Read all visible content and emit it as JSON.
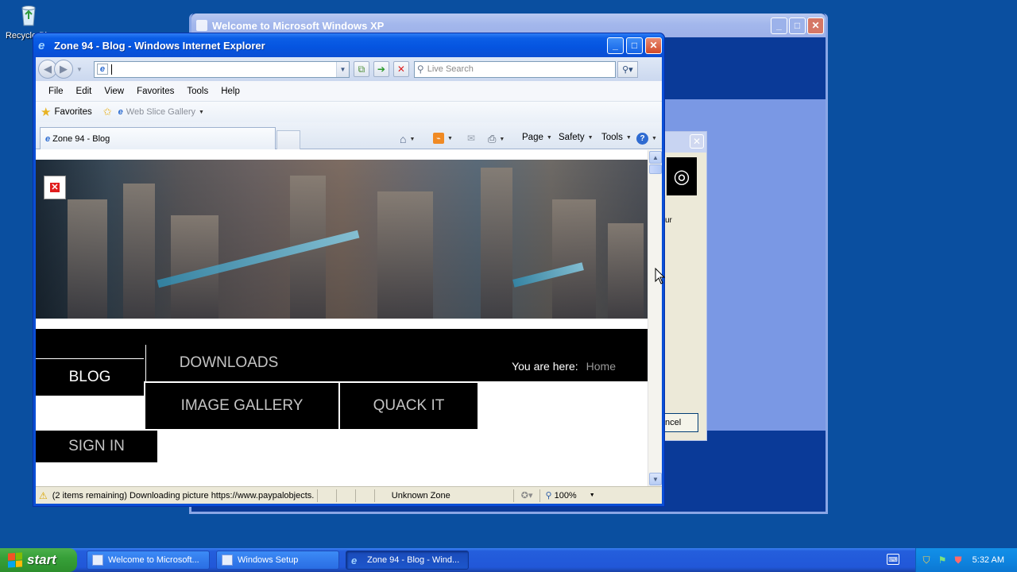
{
  "desktop": {
    "icons": [
      {
        "label": "Recycle Bin",
        "icon": "recycle-bin-icon"
      }
    ]
  },
  "bg_window": {
    "title": "Welcome to Microsoft Windows XP",
    "setup_dialog": {
      "cancel_label": "ncel",
      "text_fragment": "ur"
    }
  },
  "ie": {
    "title": "Zone 94 - Blog - Windows Internet Explorer",
    "address": {
      "value": "",
      "placeholder": ""
    },
    "search": {
      "placeholder": "Live Search"
    },
    "menu": [
      "File",
      "Edit",
      "View",
      "Favorites",
      "Tools",
      "Help"
    ],
    "favorites": {
      "label": "Favorites",
      "web_slice": "Web Slice Gallery"
    },
    "tab": {
      "label": "Zone 94 - Blog"
    },
    "commands": {
      "page": "Page",
      "safety": "Safety",
      "tools": "Tools"
    },
    "status": {
      "text": "(2 items remaining) Downloading picture https://www.paypalobjects.",
      "zone": "Unknown Zone",
      "zoom": "100%"
    }
  },
  "site": {
    "breadcrumb": {
      "label": "You are here:",
      "home": "Home"
    },
    "nav": {
      "blog": "BLOG",
      "downloads": "DOWNLOADS",
      "image_gallery": "IMAGE GALLERY",
      "quack_it": "QUACK IT",
      "sign_in": "SIGN IN"
    }
  },
  "taskbar": {
    "start": "start",
    "tasks": [
      {
        "label": "Welcome to Microsoft...",
        "active": false
      },
      {
        "label": "Windows Setup",
        "active": false
      },
      {
        "label": "Zone 94 - Blog - Wind...",
        "active": true
      }
    ],
    "clock": "5:32 AM"
  },
  "colors": {
    "desktop": "#0a4fa0",
    "xp_title_blue": "#0554e0",
    "nav_black": "#000000",
    "nav_grey_text": "#c4c4c4"
  }
}
